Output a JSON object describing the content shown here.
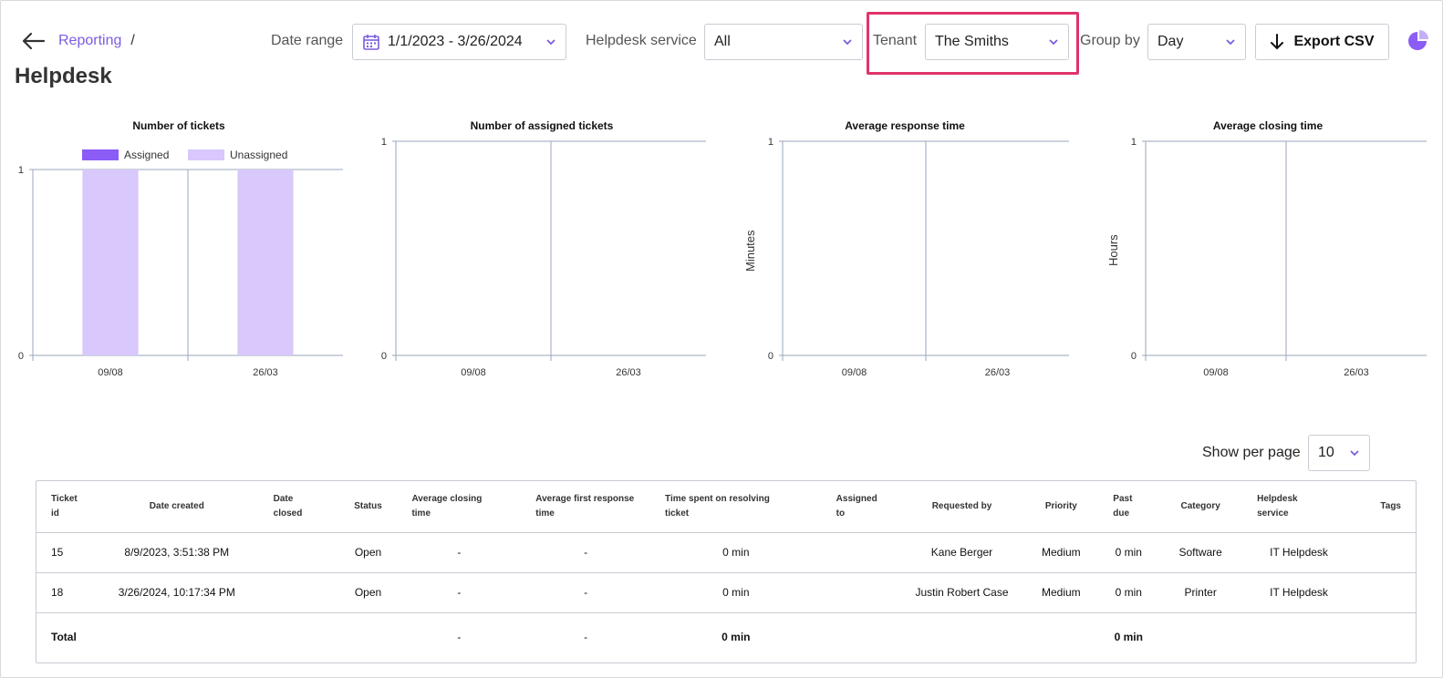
{
  "header": {
    "breadcrumb": "Reporting",
    "breadcrumb_sep": "/",
    "page_title": "Helpdesk",
    "date_range_label": "Date range",
    "date_range_value": "1/1/2023 - 3/26/2024",
    "service_label": "Helpdesk service",
    "service_value": "All",
    "tenant_label": "Tenant",
    "tenant_value": "The Smiths",
    "group_by_label": "Group by",
    "group_by_value": "Day",
    "export_label": "Export CSV"
  },
  "colors": {
    "accent": "#7c5ce0",
    "highlight": "#e0336a",
    "assigned": "#8b5cf6",
    "unassigned": "#d8c8fb",
    "axis": "#9aa7bb"
  },
  "icons": [
    "back-arrow-icon",
    "calendar-icon",
    "chevron-down-icon",
    "download-icon",
    "pie-chart-icon"
  ],
  "chart_data": [
    {
      "type": "bar",
      "title": "Number of tickets",
      "categories": [
        "09/08",
        "26/03"
      ],
      "series": [
        {
          "name": "Assigned",
          "values": [
            0,
            0
          ]
        },
        {
          "name": "Unassigned",
          "values": [
            1,
            1
          ]
        }
      ],
      "ylim": [
        0,
        1
      ],
      "yticks": [
        "0",
        "1"
      ],
      "legend": "top",
      "stacked": true
    },
    {
      "type": "bar",
      "title": "Number of assigned tickets",
      "categories": [
        "09/08",
        "26/03"
      ],
      "series": [
        {
          "values": [
            0,
            0
          ]
        }
      ],
      "ylim": [
        0,
        1
      ],
      "yticks": [
        "0",
        "1"
      ]
    },
    {
      "type": "bar",
      "title": "Average response time",
      "ylabel": "Minutes",
      "categories": [
        "09/08",
        "26/03"
      ],
      "series": [
        {
          "values": [
            0,
            0
          ]
        }
      ],
      "ylim": [
        0,
        1
      ],
      "yticks": [
        "0",
        "1"
      ]
    },
    {
      "type": "bar",
      "title": "Average closing time",
      "ylabel": "Hours",
      "categories": [
        "09/08",
        "26/03"
      ],
      "series": [
        {
          "values": [
            0,
            0
          ]
        }
      ],
      "ylim": [
        0,
        1
      ],
      "yticks": [
        "0",
        "1"
      ]
    }
  ],
  "pagination": {
    "show_per_page_label": "Show per page",
    "per_page_value": "10"
  },
  "table": {
    "columns": [
      [
        "Ticket",
        "id"
      ],
      [
        "Date created"
      ],
      [
        "Date",
        "closed"
      ],
      [
        "Status"
      ],
      [
        "Average closing",
        "time"
      ],
      [
        "Average first response",
        "time"
      ],
      [
        "Time spent on resolving",
        "ticket"
      ],
      [
        "Assigned",
        "to"
      ],
      [
        "Requested by"
      ],
      [
        "Priority"
      ],
      [
        "Past",
        "due"
      ],
      [
        "Category"
      ],
      [
        "Helpdesk",
        "service"
      ],
      [
        "Tags"
      ]
    ],
    "rows": [
      [
        "15",
        "8/9/2023, 3:51:38 PM",
        "",
        "Open",
        "-",
        "-",
        "0 min",
        "",
        "Kane Berger",
        "Medium",
        "0 min",
        "Software",
        "IT Helpdesk",
        ""
      ],
      [
        "18",
        "3/26/2024, 10:17:34 PM",
        "",
        "Open",
        "-",
        "-",
        "0 min",
        "",
        "Justin Robert Case",
        "Medium",
        "0 min",
        "Printer",
        "IT Helpdesk",
        ""
      ]
    ],
    "total": [
      "Total",
      "",
      "",
      "",
      "-",
      "-",
      "0 min",
      "",
      "",
      "",
      "0 min",
      "",
      "",
      ""
    ]
  }
}
